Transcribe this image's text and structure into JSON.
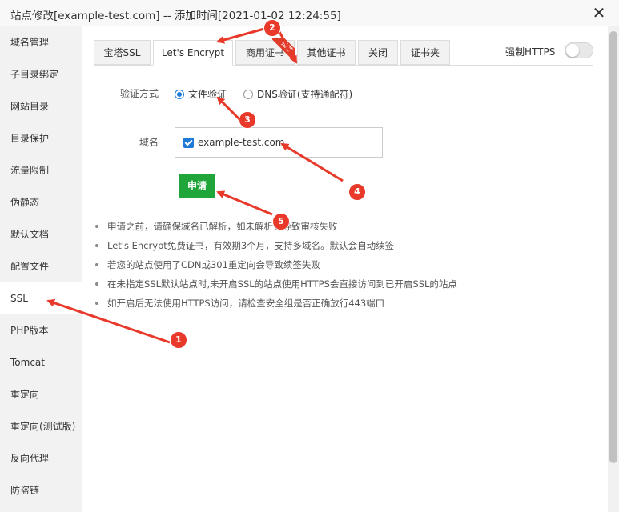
{
  "window": {
    "title": "站点修改[example-test.com] -- 添加时间[2021-01-02 12:24:55]",
    "close_icon": "close-icon"
  },
  "sidebar": {
    "items": [
      {
        "label": "域名管理"
      },
      {
        "label": "子目录绑定"
      },
      {
        "label": "网站目录"
      },
      {
        "label": "目录保护"
      },
      {
        "label": "流量限制"
      },
      {
        "label": "伪静态"
      },
      {
        "label": "默认文档"
      },
      {
        "label": "配置文件"
      },
      {
        "label": "SSL",
        "active": true
      },
      {
        "label": "PHP版本"
      },
      {
        "label": "Tomcat"
      },
      {
        "label": "重定向"
      },
      {
        "label": "重定向(测试版)"
      },
      {
        "label": "反向代理"
      },
      {
        "label": "防盗链"
      }
    ]
  },
  "tabs": [
    {
      "label": "宝塔SSL"
    },
    {
      "label": "Let's Encrypt",
      "active": true
    },
    {
      "label": "商用证书",
      "ribbon": "推荐"
    },
    {
      "label": "其他证书"
    },
    {
      "label": "关闭"
    },
    {
      "label": "证书夹"
    }
  ],
  "force_https": {
    "label": "强制HTTPS",
    "enabled": false
  },
  "form": {
    "verify_label": "验证方式",
    "verify_options": [
      {
        "label": "文件验证",
        "checked": true
      },
      {
        "label": "DNS验证(支持通配符)",
        "checked": false
      }
    ],
    "domain_label": "域名",
    "domains": [
      {
        "label": "example-test.com",
        "checked": true
      }
    ],
    "apply_label": "申请"
  },
  "tips": [
    "申请之前，请确保域名已解析，如未解析会导致审核失败",
    "Let's Encrypt免费证书，有效期3个月，支持多域名。默认会自动续签",
    "若您的站点使用了CDN或301重定向会导致续签失败",
    "在未指定SSL默认站点时,未开启SSL的站点使用HTTPS会直接访问到已开启SSL的站点",
    "如开启后无法使用HTTPS访问，请检查安全组是否正确放行443端口"
  ],
  "annotations": {
    "color": "#e8392a",
    "badges": [
      "1",
      "2",
      "3",
      "4",
      "5"
    ]
  },
  "colors": {
    "accent": "#1e7ad6",
    "apply": "#20a53a",
    "annotation": "#e8392a"
  }
}
